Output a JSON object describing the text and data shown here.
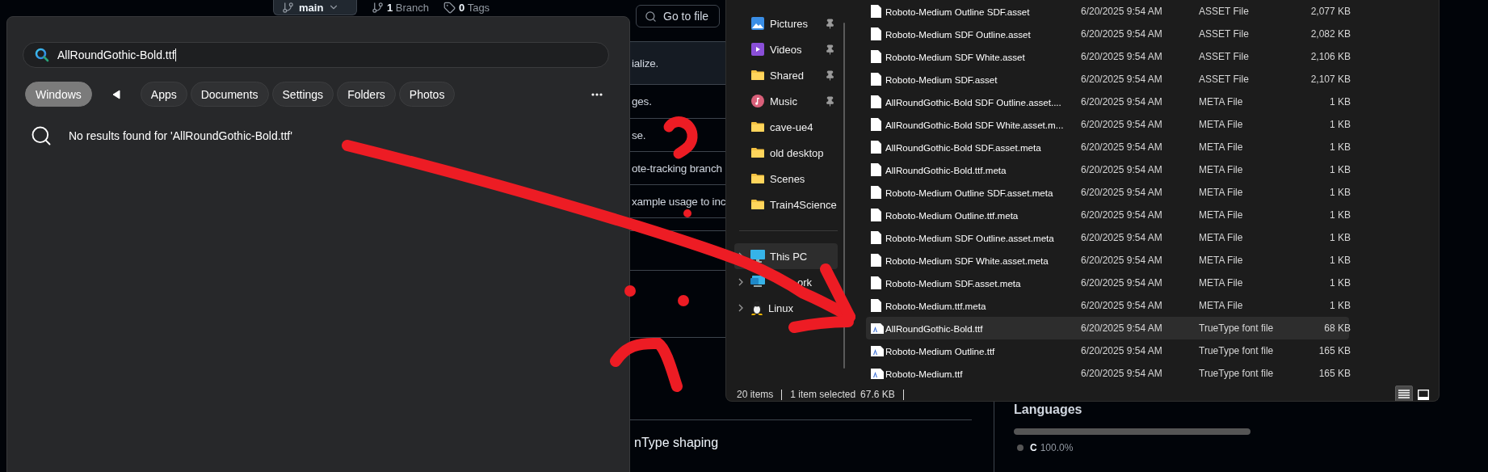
{
  "github": {
    "branch_button": "main",
    "branches": "**1** Branch",
    "tags": "**0** Tags",
    "go_to_file": "Go to file",
    "commit_rows": [
      {
        "message": "ialize.",
        "highlighted": true
      },
      {
        "message": "ges.",
        "highlighted": false
      },
      {
        "message": "se.",
        "highlighted": false
      },
      {
        "message": "ote-tracking branch",
        "highlighted": false
      },
      {
        "message": "xample usage to inc",
        "highlighted": false
      }
    ],
    "readme_line": "nType shaping",
    "languages": {
      "title": "Languages",
      "items": [
        {
          "name": "C",
          "share": "100.0%",
          "level": 1.0,
          "color": "#555555"
        }
      ]
    }
  },
  "search": {
    "query": "AllRoundGothic-Bold.ttf",
    "filters": [
      {
        "label": "Windows",
        "selected": true
      },
      {
        "label": "Apps",
        "selected": false
      },
      {
        "label": "Documents",
        "selected": false
      },
      {
        "label": "Settings",
        "selected": false
      },
      {
        "label": "Folders",
        "selected": false
      },
      {
        "label": "Photos",
        "selected": false
      }
    ],
    "message": "No results found for 'AllRoundGothic-Bold.ttf'"
  },
  "explorer": {
    "nav": [
      {
        "label": "Pictures",
        "kind": "pictures",
        "pinned": true
      },
      {
        "label": "Videos",
        "kind": "videos",
        "pinned": true
      },
      {
        "label": "Shared",
        "kind": "folder",
        "pinned": true
      },
      {
        "label": "Music",
        "kind": "music",
        "pinned": true
      },
      {
        "label": "cave-ue4",
        "kind": "folder",
        "pinned": false
      },
      {
        "label": "old desktop",
        "kind": "folder",
        "pinned": false
      },
      {
        "label": "Scenes",
        "kind": "folder",
        "pinned": false
      },
      {
        "label": "Train4Science",
        "kind": "folder",
        "pinned": false
      }
    ],
    "drives": [
      {
        "label": "This PC",
        "kind": "pc",
        "selected": true
      },
      {
        "label": "ork",
        "kind": "network",
        "selected": false
      },
      {
        "label": "Linux",
        "kind": "linux",
        "selected": false
      }
    ],
    "files": [
      {
        "name": "Roboto-Medium Outline SDF.asset",
        "modified": "6/20/2025 9:54 AM",
        "type": "ASSET File",
        "size": "2,077 KB",
        "kind": "asset",
        "selected": false
      },
      {
        "name": "Roboto-Medium SDF Outline.asset",
        "modified": "6/20/2025 9:54 AM",
        "type": "ASSET File",
        "size": "2,082 KB",
        "kind": "asset",
        "selected": false
      },
      {
        "name": "Roboto-Medium SDF White.asset",
        "modified": "6/20/2025 9:54 AM",
        "type": "ASSET File",
        "size": "2,106 KB",
        "kind": "asset",
        "selected": false
      },
      {
        "name": "Roboto-Medium SDF.asset",
        "modified": "6/20/2025 9:54 AM",
        "type": "ASSET File",
        "size": "2,107 KB",
        "kind": "asset",
        "selected": false
      },
      {
        "name": "AllRoundGothic-Bold SDF Outline.asset....",
        "modified": "6/20/2025 9:54 AM",
        "type": "META File",
        "size": "1 KB",
        "kind": "asset",
        "selected": false
      },
      {
        "name": "AllRoundGothic-Bold SDF White.asset.m...",
        "modified": "6/20/2025 9:54 AM",
        "type": "META File",
        "size": "1 KB",
        "kind": "asset",
        "selected": false
      },
      {
        "name": "AllRoundGothic-Bold SDF.asset.meta",
        "modified": "6/20/2025 9:54 AM",
        "type": "META File",
        "size": "1 KB",
        "kind": "asset",
        "selected": false
      },
      {
        "name": "AllRoundGothic-Bold.ttf.meta",
        "modified": "6/20/2025 9:54 AM",
        "type": "META File",
        "size": "1 KB",
        "kind": "asset",
        "selected": false
      },
      {
        "name": "Roboto-Medium Outline SDF.asset.meta",
        "modified": "6/20/2025 9:54 AM",
        "type": "META File",
        "size": "1 KB",
        "kind": "asset",
        "selected": false
      },
      {
        "name": "Roboto-Medium Outline.ttf.meta",
        "modified": "6/20/2025 9:54 AM",
        "type": "META File",
        "size": "1 KB",
        "kind": "asset",
        "selected": false
      },
      {
        "name": "Roboto-Medium SDF Outline.asset.meta",
        "modified": "6/20/2025 9:54 AM",
        "type": "META File",
        "size": "1 KB",
        "kind": "asset",
        "selected": false
      },
      {
        "name": "Roboto-Medium SDF White.asset.meta",
        "modified": "6/20/2025 9:54 AM",
        "type": "META File",
        "size": "1 KB",
        "kind": "asset",
        "selected": false
      },
      {
        "name": "Roboto-Medium SDF.asset.meta",
        "modified": "6/20/2025 9:54 AM",
        "type": "META File",
        "size": "1 KB",
        "kind": "asset",
        "selected": false
      },
      {
        "name": "Roboto-Medium.ttf.meta",
        "modified": "6/20/2025 9:54 AM",
        "type": "META File",
        "size": "1 KB",
        "kind": "asset",
        "selected": false
      },
      {
        "name": "AllRoundGothic-Bold.ttf",
        "modified": "6/20/2025 9:54 AM",
        "type": "TrueType font file",
        "size": "68 KB",
        "kind": "font",
        "selected": true
      },
      {
        "name": "Roboto-Medium Outline.ttf",
        "modified": "6/20/2025 9:54 AM",
        "type": "TrueType font file",
        "size": "165 KB",
        "kind": "font",
        "selected": false
      },
      {
        "name": "Roboto-Medium.ttf",
        "modified": "6/20/2025 9:54 AM",
        "type": "TrueType font file",
        "size": "165 KB",
        "kind": "font",
        "selected": false
      }
    ],
    "status": {
      "count": "20 items",
      "selection": "1 item selected",
      "size": "67.6 KB"
    },
    "view_buttons": [
      {
        "kind": "details",
        "selected": true
      },
      {
        "kind": "preview",
        "selected": false
      }
    ]
  }
}
